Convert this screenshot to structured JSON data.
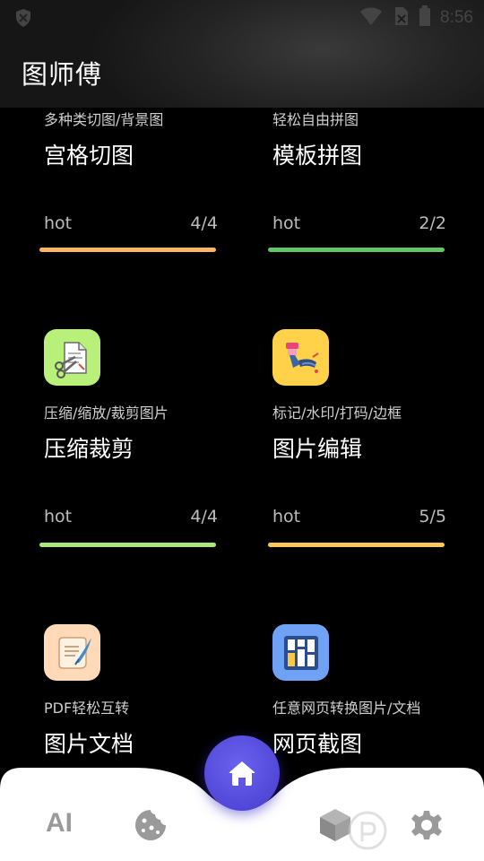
{
  "status_bar": {
    "time": "8:56"
  },
  "app": {
    "title": "图师傅"
  },
  "cards": [
    {
      "subtitle": "多种类切图/背景图",
      "title": "宫格切图",
      "tag": "hot",
      "count": "4/4",
      "bar_color": "#f9b46a",
      "icon": "grid-cut-icon"
    },
    {
      "subtitle": "轻松自由拼图",
      "title": "模板拼图",
      "tag": "hot",
      "count": "2/2",
      "bar_color": "#63c46c",
      "icon": "template-collage-icon"
    },
    {
      "subtitle": "压缩/缩放/裁剪图片",
      "title": "压缩裁剪",
      "tag": "hot",
      "count": "4/4",
      "bar_color": "#a9e87a",
      "icon": "scissors-document-icon"
    },
    {
      "subtitle": "标记/水印/打码/边框",
      "title": "图片编辑",
      "tag": "hot",
      "count": "5/5",
      "bar_color": "#f8c95a",
      "icon": "paint-brush-icon"
    },
    {
      "subtitle": "PDF轻松互转",
      "title": "图片文档",
      "icon": "scroll-quill-icon"
    },
    {
      "subtitle": "任意网页转换图片/文档",
      "title": "网页截图",
      "icon": "web-layout-icon"
    }
  ],
  "bottom_nav": {
    "ai_label": "AI",
    "items": [
      "ai",
      "cookie-icon",
      "home-icon",
      "cube-icon",
      "settings-gear-icon"
    ]
  },
  "colors": {
    "accent": "#5a51e0",
    "nav_background": "#ffffff",
    "icon_bg_green": "#b8f07a",
    "icon_bg_yellow": "#ffd24a",
    "icon_bg_peach": "#ffd9b8",
    "icon_bg_blue": "#6fa2f5"
  }
}
